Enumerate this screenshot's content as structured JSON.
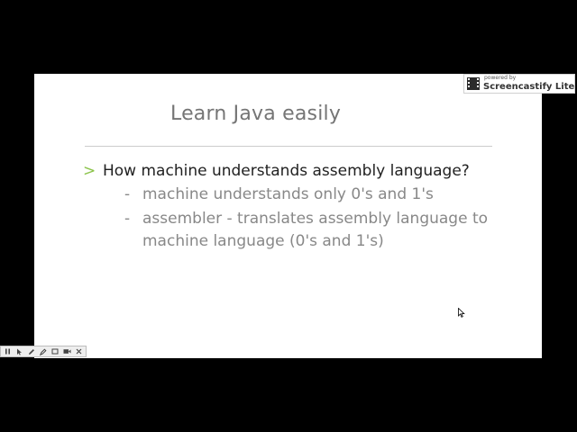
{
  "slide": {
    "title": "Learn Java easily",
    "bullets": [
      {
        "marker": ">",
        "text": "How machine understands assembly language?",
        "sub": [
          {
            "marker": "-",
            "text": "machine understands only 0's and 1's"
          },
          {
            "marker": "-",
            "text": "assembler - translates assembly language to machine language (0's and 1's)"
          }
        ]
      }
    ]
  },
  "watermark": {
    "small_text": "powered by",
    "brand": "Screencastify Lite"
  },
  "toolbar": {
    "tools": [
      "pause-icon",
      "pointer-icon",
      "pen-icon",
      "highlighter-icon",
      "rectangle-icon",
      "camera-icon",
      "close-icon"
    ]
  },
  "colors": {
    "background": "#000000",
    "slide": "#ffffff",
    "title": "#757575",
    "bullet_marker": "#8bc34a",
    "primary_text": "#212121",
    "secondary_text": "#888888"
  }
}
